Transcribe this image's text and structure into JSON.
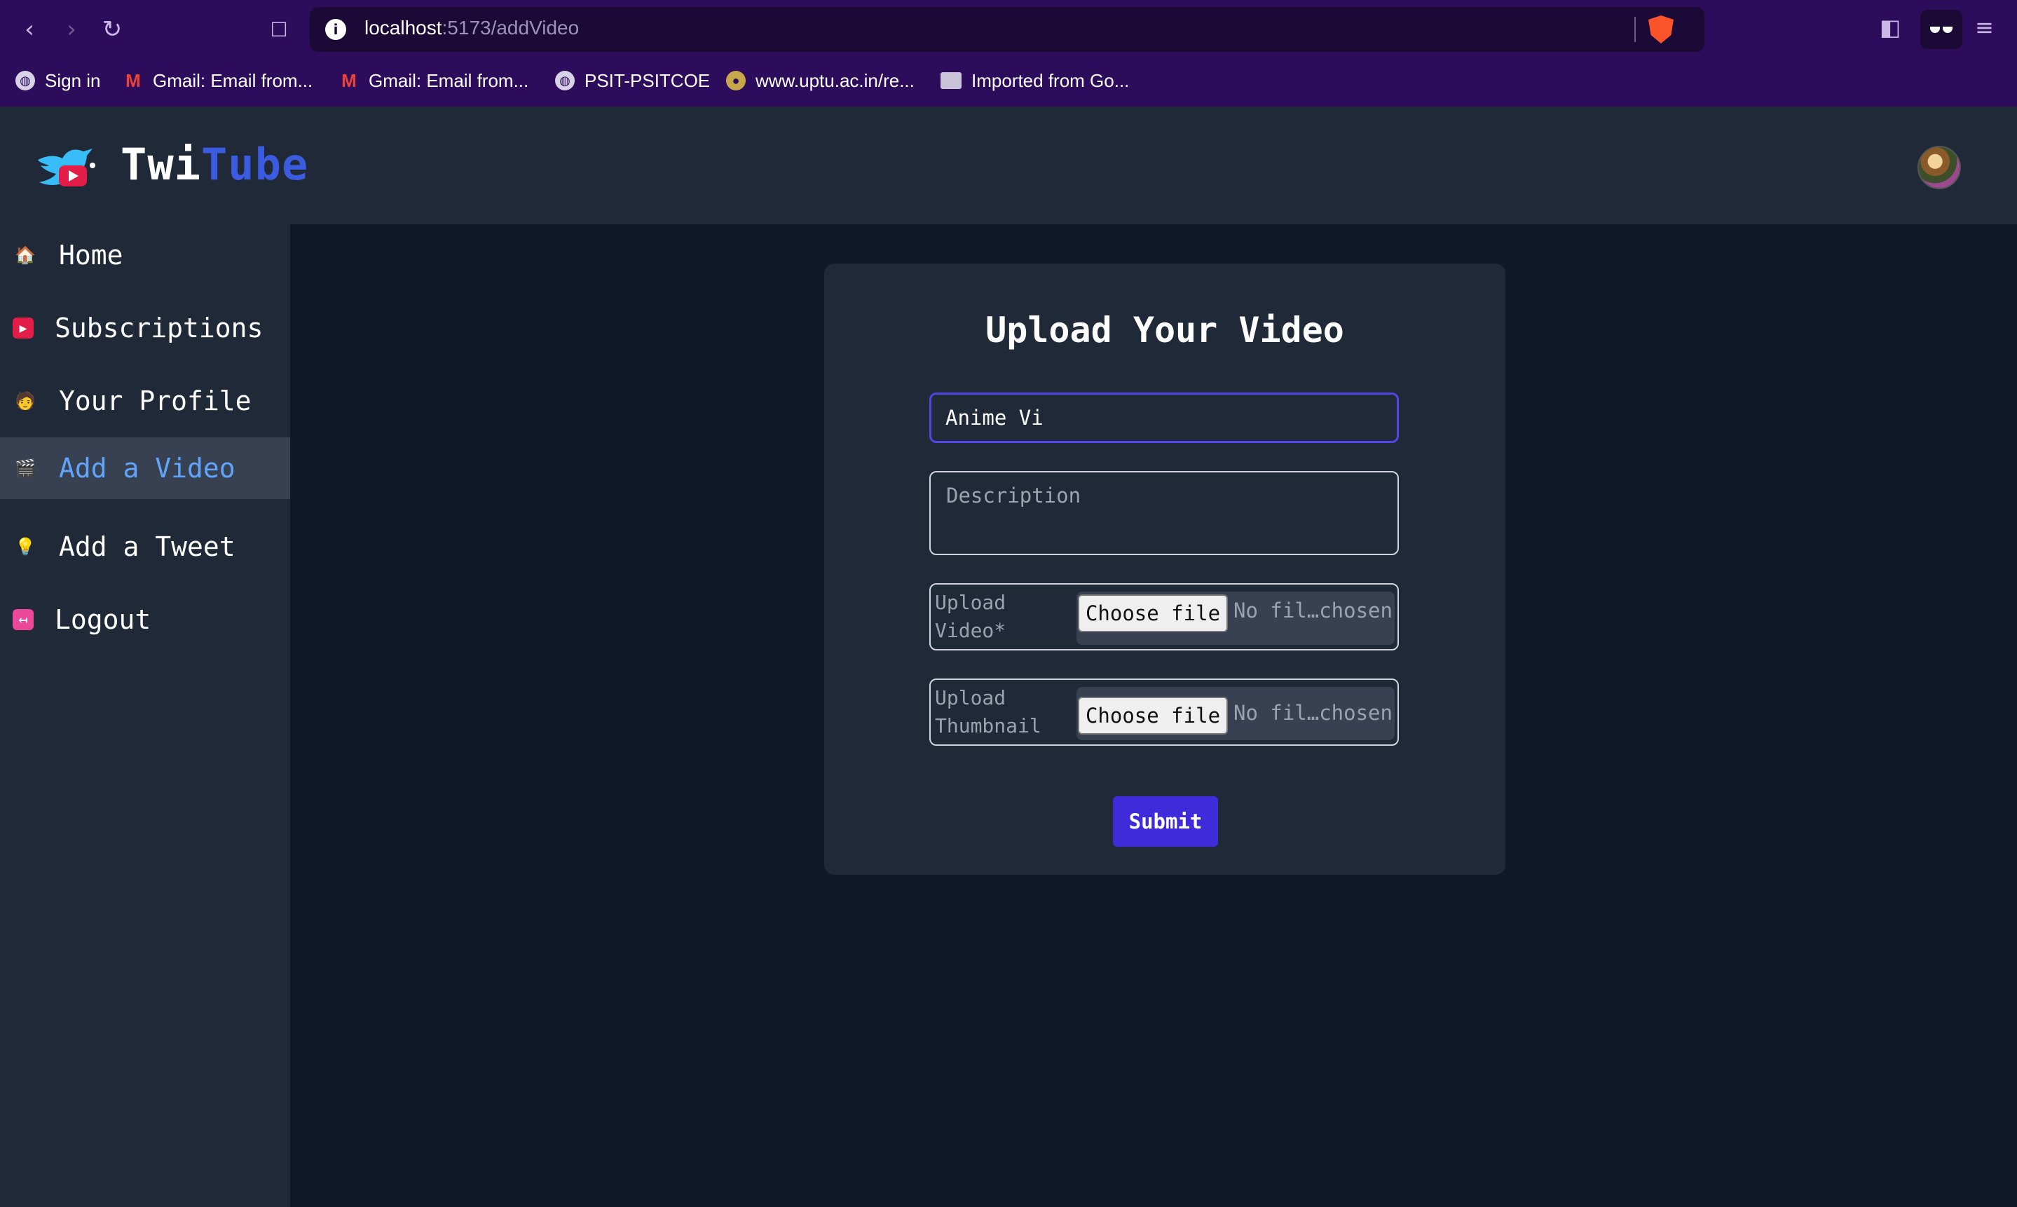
{
  "browser": {
    "url_host": "localhost",
    "url_path": ":5173/addVideo",
    "bookmarks": [
      {
        "label": "Sign in",
        "icon": "globe-icon"
      },
      {
        "label": "Gmail: Email from...",
        "icon": "gmail-icon"
      },
      {
        "label": "Gmail: Email from...",
        "icon": "gmail-icon"
      },
      {
        "label": "PSIT-PSITCOE",
        "icon": "globe-icon"
      },
      {
        "label": "www.uptu.ac.in/re...",
        "icon": "seal-icon"
      },
      {
        "label": "Imported from Go...",
        "icon": "folder-icon"
      }
    ]
  },
  "header": {
    "logo_part1": "Twi",
    "logo_part2": "Tube",
    "brand_color_primary": "#ffffff",
    "brand_color_accent": "#3b5be0"
  },
  "sidebar": {
    "items": [
      {
        "label": "Home",
        "icon": "house-icon"
      },
      {
        "label": "Subscriptions",
        "icon": "play-icon"
      },
      {
        "label": "Your Profile",
        "icon": "person-icon"
      },
      {
        "label": "Add a Video",
        "icon": "clapperboard-icon",
        "active": true
      },
      {
        "label": "Add a Tweet",
        "icon": "lightbulb-icon"
      },
      {
        "label": "Logout",
        "icon": "logout-icon"
      }
    ]
  },
  "form": {
    "title": "Upload Your Video",
    "title_value": "Anime Vi",
    "description_placeholder": "Description",
    "video_label_line1": "Upload",
    "video_label_line2": "Video*",
    "thumbnail_label_line1": "Upload",
    "thumbnail_label_line2": "Thumbnail",
    "choose_file": "Choose file",
    "no_file": "No fil…chosen",
    "submit": "Submit",
    "accent_color": "#4f46e5"
  }
}
